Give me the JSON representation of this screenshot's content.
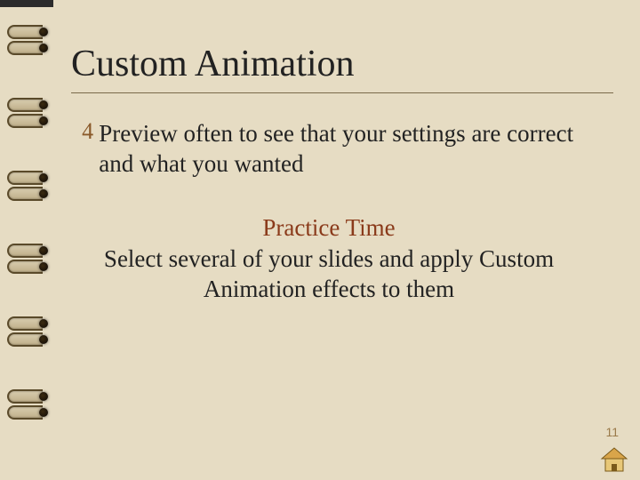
{
  "title": "Custom Animation",
  "bullet": {
    "marker": "4",
    "text": "Preview often to see that your settings are correct and what you wanted"
  },
  "practice": {
    "heading": "Practice Time",
    "body": "Select several of your slides and apply Custom Animation effects to them"
  },
  "page_number": "11",
  "icons": {
    "home": "home-icon"
  },
  "colors": {
    "background": "#e6dcc3",
    "title": "#222222",
    "accent": "#8a3a1a",
    "bullet_marker": "#8a5a2a"
  }
}
